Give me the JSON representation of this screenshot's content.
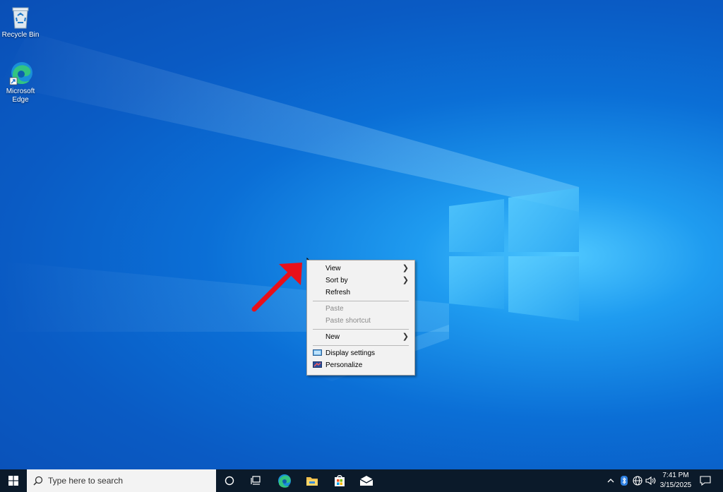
{
  "desktop": {
    "icons": [
      {
        "label": "Recycle Bin",
        "icon": "recycle-bin-icon"
      },
      {
        "label": "Microsoft Edge",
        "icon": "edge-icon"
      }
    ]
  },
  "context_menu": {
    "items": [
      {
        "label": "View",
        "submenu": true,
        "enabled": true
      },
      {
        "label": "Sort by",
        "submenu": true,
        "enabled": true
      },
      {
        "label": "Refresh",
        "submenu": false,
        "enabled": true
      },
      {
        "label": "Paste",
        "submenu": false,
        "enabled": false
      },
      {
        "label": "Paste shortcut",
        "submenu": false,
        "enabled": false
      },
      {
        "label": "New",
        "submenu": true,
        "enabled": true
      },
      {
        "label": "Display settings",
        "icon": "display-icon",
        "enabled": true
      },
      {
        "label": "Personalize",
        "icon": "personalize-icon",
        "enabled": true
      }
    ]
  },
  "taskbar": {
    "search_placeholder": "Type here to search",
    "pinned": [
      "cortana-icon",
      "task-view-icon",
      "edge-icon",
      "file-explorer-icon",
      "store-icon",
      "mail-icon"
    ],
    "clock_time": "7:41 PM",
    "clock_date": "3/15/2025"
  },
  "colors": {
    "desktop_blue": "#0a5bc4",
    "taskbar": "#0b1a2a",
    "annotation_arrow": "#e8101a"
  }
}
